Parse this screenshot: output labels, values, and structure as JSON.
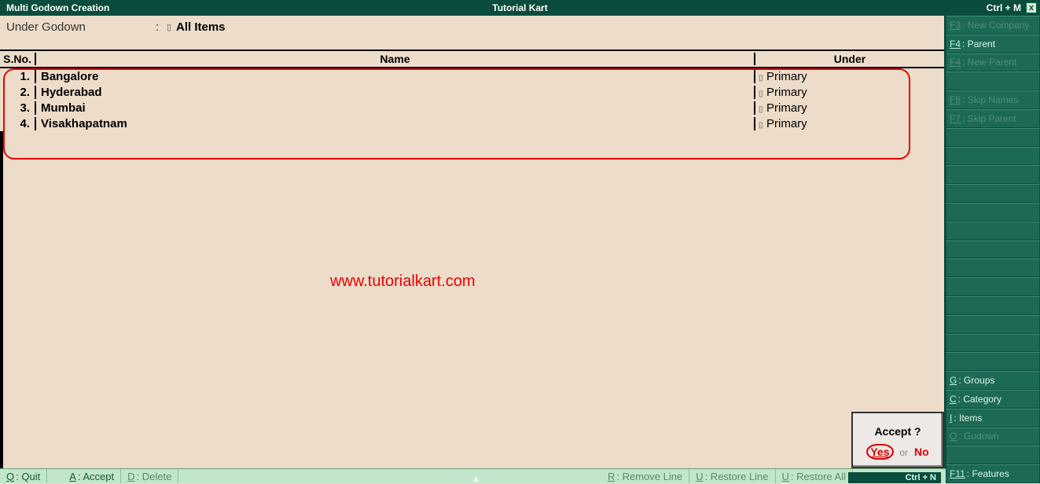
{
  "titlebar": {
    "left": "Multi Godown  Creation",
    "center": "Tutorial Kart",
    "right": "Ctrl + M",
    "close": "x"
  },
  "under": {
    "label": "Under Godown",
    "colon": ":",
    "marker": "▯",
    "value": "All Items"
  },
  "columns": {
    "sno": "S.No.",
    "name": "Name",
    "under": "Under"
  },
  "rows": [
    {
      "sno": "1.",
      "name": "Bangalore",
      "under": "Primary"
    },
    {
      "sno": "2.",
      "name": "Hyderabad",
      "under": "Primary"
    },
    {
      "sno": "3.",
      "name": "Mumbai",
      "under": "Primary"
    },
    {
      "sno": "4.",
      "name": "Visakhapatnam",
      "under": "Primary"
    }
  ],
  "watermark": "www.tutorialkart.com",
  "accept": {
    "question": "Accept ?",
    "yes": "Yes",
    "or": "or",
    "no": "No"
  },
  "bottom": {
    "quit": {
      "key": "Q",
      "label": ": Quit"
    },
    "accept": {
      "key": "A",
      "label": ": Accept"
    },
    "delete": {
      "key": "D",
      "label": ": Delete"
    },
    "remove": {
      "key": "R",
      "label": ": Remove Line"
    },
    "restore": {
      "key": "U",
      "label": ": Restore Line"
    },
    "restoreall": {
      "key": "U",
      "label": ": Restore All"
    }
  },
  "ctrln": "Ctrl + N",
  "sidebar": {
    "f3": {
      "key": "F3",
      "label": ": New Company"
    },
    "f4a": {
      "key": "F4",
      "label": ": Parent"
    },
    "f4b": {
      "key": "F4",
      "label": ": New Parent"
    },
    "f6": {
      "key": "F6",
      "label": ": Skip Names"
    },
    "f7": {
      "key": "F7",
      "label": ": Skip Parent"
    },
    "g": {
      "key": "G",
      "label": ": Groups"
    },
    "c": {
      "key": "C",
      "label": ": Category"
    },
    "i": {
      "key": "I",
      "label": ": Items"
    },
    "o": {
      "key": "O",
      "label": ": Godown"
    },
    "f11": {
      "key": "F11",
      "label": ": Features"
    }
  }
}
